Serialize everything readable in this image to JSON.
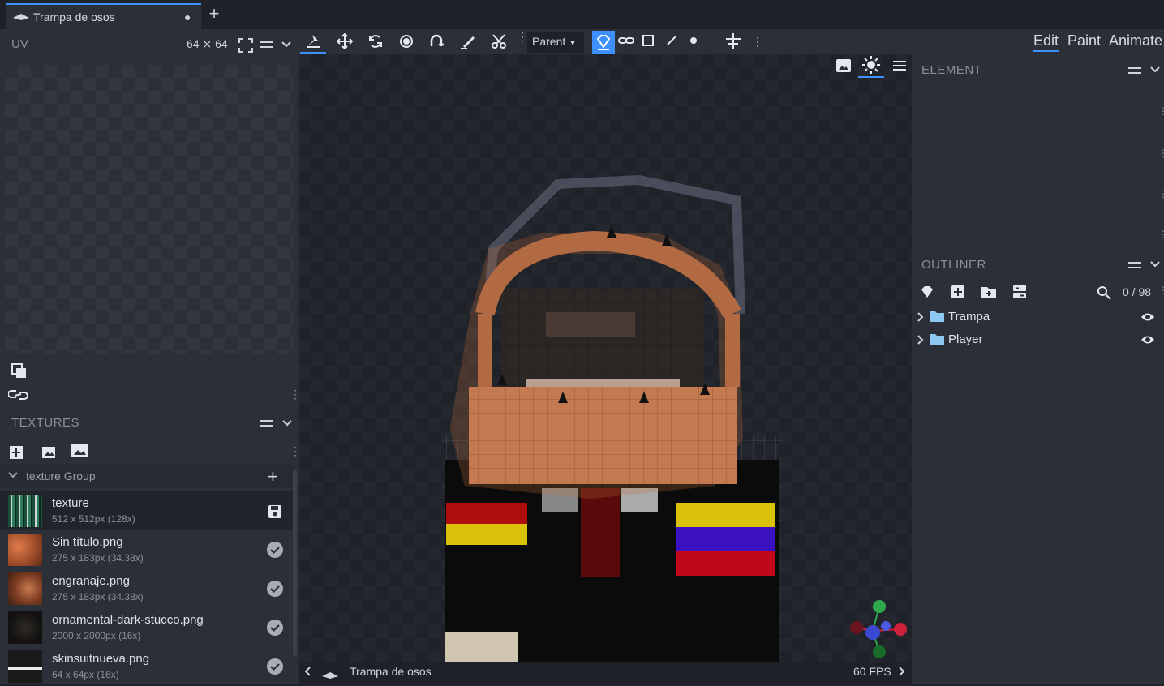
{
  "tab": {
    "title": "Trampa de osos",
    "unsaved_marker": "●",
    "new_tab": "+"
  },
  "uv_panel": {
    "label": "UV",
    "size": "64 ⨯ 64"
  },
  "toolbar": {
    "tools": [
      "move-tool-icon",
      "translate-icon",
      "rotate-icon",
      "pivot-icon",
      "resize-icon",
      "vertex-snap-icon",
      "knife-icon"
    ],
    "parent_select": "Parent",
    "selection_modes": [
      "object-mode-icon",
      "link-mode-icon",
      "face-mode-icon",
      "edge-mode-icon",
      "vertex-mode-icon"
    ]
  },
  "modes": {
    "edit": "Edit",
    "paint": "Paint",
    "animate": "Animate",
    "active": "Edit"
  },
  "textures": {
    "header": "TEXTURES",
    "group_label": "texture Group",
    "items": [
      {
        "name": "texture",
        "dims": "512 x 512px (128x)",
        "status": "unsaved"
      },
      {
        "name": "Sin título.png",
        "dims": "275 x 183px (34.38x)",
        "status": "saved"
      },
      {
        "name": "engranaje.png",
        "dims": "275 x 183px (34.38x)",
        "status": "saved"
      },
      {
        "name": "ornamental-dark-stucco.png",
        "dims": "2000 x 2000px (16x)",
        "status": "saved"
      },
      {
        "name": "skinsuitnueva.png",
        "dims": "64 x 64px (16x)",
        "status": "saved"
      }
    ]
  },
  "viewport": {
    "model_name": "Trampa de osos",
    "fps": "60 FPS"
  },
  "element_panel": {
    "header": "ELEMENT"
  },
  "outliner": {
    "header": "OUTLINER",
    "count": "0 / 98",
    "items": [
      {
        "name": "Trampa"
      },
      {
        "name": "Player"
      }
    ]
  },
  "colors": {
    "accent": "#3e90ff",
    "panel": "#2a2f38",
    "background": "#1e2127",
    "folder": "#8cc8f0"
  }
}
